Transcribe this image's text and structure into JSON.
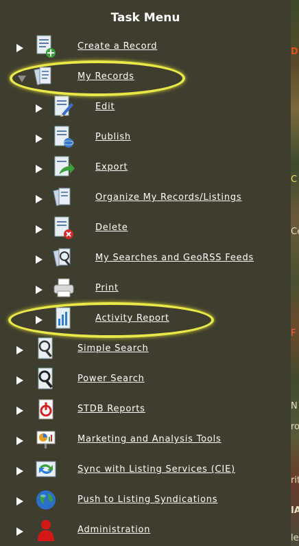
{
  "title": "Task Menu",
  "items": [
    {
      "label": "Create a Record",
      "icon": "create-record-icon"
    },
    {
      "label": "My Records",
      "icon": "my-records-icon",
      "expanded": true
    },
    {
      "label": "Edit",
      "icon": "edit-icon"
    },
    {
      "label": "Publish",
      "icon": "publish-icon"
    },
    {
      "label": "Export",
      "icon": "export-icon"
    },
    {
      "label": "Organize My Records/Listings",
      "icon": "organize-icon"
    },
    {
      "label": "Delete",
      "icon": "delete-icon"
    },
    {
      "label": "My Searches and GeoRSS Feeds",
      "icon": "searches-feeds-icon"
    },
    {
      "label": "Print",
      "icon": "printer-icon"
    },
    {
      "label": "Activity Report",
      "icon": "activity-report-icon"
    },
    {
      "label": "Simple Search",
      "icon": "simple-search-icon"
    },
    {
      "label": "Power Search",
      "icon": "power-search-icon"
    },
    {
      "label": "STDB Reports",
      "icon": "stdb-reports-icon"
    },
    {
      "label": "Marketing and Analysis Tools",
      "icon": "marketing-tools-icon"
    },
    {
      "label": "Sync with Listing Services (CIE)",
      "icon": "sync-icon"
    },
    {
      "label": "Push to Listing Syndications",
      "icon": "globe-icon"
    },
    {
      "label": "Administration",
      "icon": "administration-icon"
    }
  ],
  "background_strip_text": [
    "D",
    "C",
    "Ce",
    "F",
    "N",
    "ro",
    "rit",
    "IA",
    "le"
  ],
  "colors": {
    "menu_bg": "#3f3e2e",
    "text": "#ffffff",
    "highlight": "#e8e84a"
  }
}
